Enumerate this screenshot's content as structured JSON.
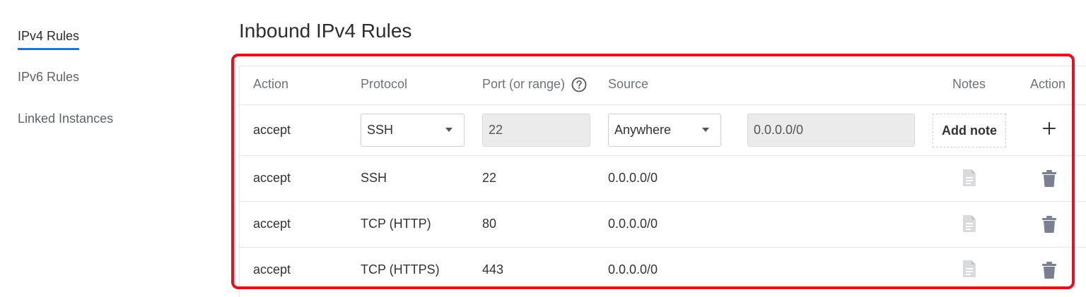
{
  "sidebar": {
    "items": [
      {
        "label": "IPv4 Rules",
        "active": true
      },
      {
        "label": "IPv6 Rules",
        "active": false
      },
      {
        "label": "Linked Instances",
        "active": false
      }
    ]
  },
  "main": {
    "title": "Inbound IPv4 Rules",
    "table": {
      "headers": {
        "action": "Action",
        "protocol": "Protocol",
        "port": "Port (or range)",
        "source": "Source",
        "notes": "Notes",
        "action_right": "Action"
      },
      "new_rule": {
        "action": "accept",
        "protocol": "SSH",
        "port": "22",
        "source_select": "Anywhere",
        "source_value": "0.0.0.0/0",
        "add_note_label": "Add note"
      },
      "rows": [
        {
          "action": "accept",
          "protocol": "SSH",
          "port": "22",
          "source": "0.0.0.0/0"
        },
        {
          "action": "accept",
          "protocol": "TCP (HTTP)",
          "port": "80",
          "source": "0.0.0.0/0"
        },
        {
          "action": "accept",
          "protocol": "TCP (HTTPS)",
          "port": "443",
          "source": "0.0.0.0/0"
        }
      ]
    }
  },
  "icons": {
    "help": "help-circle-icon",
    "add": "plus-icon",
    "note": "note-icon",
    "delete": "trash-icon"
  },
  "colors": {
    "accent": "#1f73d6",
    "highlight": "#e8101b",
    "icon_gray": "#7a8090"
  }
}
